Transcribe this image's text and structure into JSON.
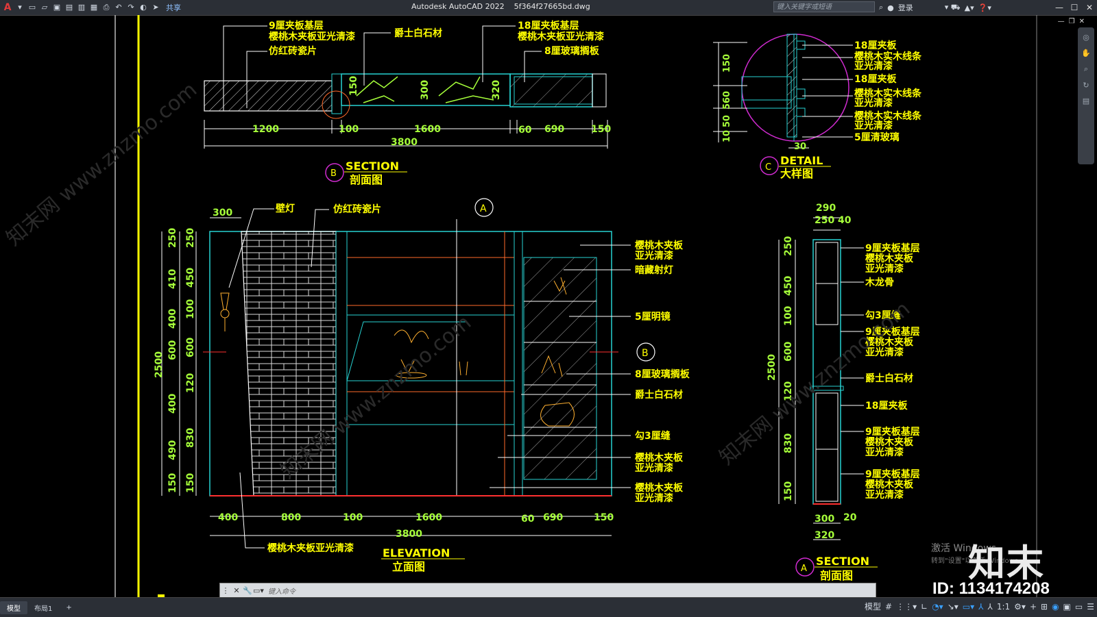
{
  "app": {
    "title": "Autodesk AutoCAD 2022",
    "file": "5f364f27665bd.dwg",
    "search_placeholder": "键入关键字或短语",
    "login": "登录",
    "share": "共享",
    "logo": "A"
  },
  "tabs": {
    "model": "模型",
    "layout1": "布局1",
    "add": "+"
  },
  "cmd": {
    "placeholder": "键入命令"
  },
  "status": {
    "model": "模型",
    "scale": "1:1"
  },
  "section_b": {
    "title_en": "SECTION",
    "title_cn": "剖面图",
    "tag": "B",
    "labels": [
      "9厘夹板基层",
      "樱桃木夹板亚光清漆",
      "仿红砖瓷片",
      "爵士白石材",
      "18厘夹板基层",
      "樱桃木夹板亚光清漆",
      "8厘玻璃搁板"
    ],
    "dims_top": [
      "1200",
      "100",
      "1600",
      "60",
      "690",
      "150"
    ],
    "dims_inside": [
      "150",
      "300",
      "320"
    ],
    "total": "3800"
  },
  "detail_c": {
    "title_en": "DETAIL",
    "title_cn": "大样图",
    "tag": "C",
    "labels": [
      "18厘夹板",
      "樱桃木实木线条",
      "亚光清漆",
      "18厘夹板",
      "樱桃木实木线条",
      "亚光清漆",
      "樱桃木实木线条",
      "亚光清漆",
      "5厘清玻璃"
    ],
    "dims_v": [
      "150",
      "560",
      "50",
      "10"
    ],
    "dim_h": "30"
  },
  "elevation": {
    "title_en": "ELEVATION",
    "title_cn": "立面图",
    "labels_top": [
      "300",
      "壁灯",
      "仿红砖瓷片"
    ],
    "labels_right": [
      "樱桃木夹板",
      "亚光清漆",
      "暗藏射灯",
      "5厘明镜",
      "8厘玻璃搁板",
      "爵士白石材",
      "勾3厘缝",
      "樱桃木夹板",
      "亚光清漆",
      "樱桃木夹板",
      "亚光清漆"
    ],
    "label_bottom": "樱桃木夹板亚光清漆",
    "dims_left_outer": [
      "250",
      "410",
      "400",
      "600",
      "400",
      "490",
      "150"
    ],
    "dims_left_inner": [
      "250",
      "450",
      "100",
      "600",
      "120",
      "830",
      "150"
    ],
    "dim_total_v": "2500",
    "dims_bottom": [
      "400",
      "800",
      "100",
      "1600",
      "60",
      "690",
      "150"
    ],
    "total": "3800",
    "markers": [
      "A",
      "B"
    ]
  },
  "section_a": {
    "title_en": "SECTION",
    "title_cn": "剖面图",
    "tag": "A",
    "top_dims": [
      "290",
      "250",
      "40"
    ],
    "bottom_dims": [
      "300",
      "20",
      "320"
    ],
    "dims_v": [
      "250",
      "450",
      "100",
      "600",
      "120",
      "830",
      "150"
    ],
    "dim_total_v": "2500",
    "labels": [
      "9厘夹板基层",
      "樱桃木夹板",
      "亚光清漆",
      "木龙骨",
      "勾3厘缝",
      "9厘夹板基层",
      "樱桃木夹板",
      "亚光清漆",
      "爵士白石材",
      "18厘夹板",
      "9厘夹板基层",
      "樱桃木夹板",
      "亚光清漆",
      "9厘夹板基层",
      "樱桃木夹板",
      "亚光清漆"
    ]
  },
  "watermark": {
    "activate": "激活 Windows",
    "activate_sub": "转到\"设置\"以激活 Windows。",
    "logo": "知末",
    "id": "ID: 1134174208",
    "site": "知末网 www.znzmo.com"
  },
  "colors": {
    "green": "#a6ff3a",
    "yellow": "#ffff00",
    "cyan": "#27d3d3",
    "magenta": "#d02bd0",
    "orange": "#ff6a2a",
    "white": "#ffffff",
    "red": "#ff3030"
  }
}
